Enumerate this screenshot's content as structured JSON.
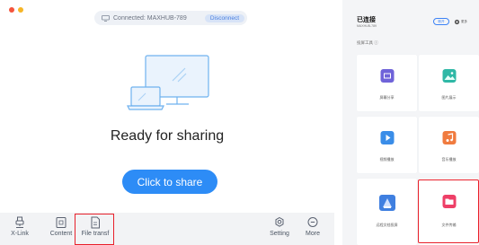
{
  "desktop": {
    "connection_text": "Connected: MAXHUB-789",
    "disconnect_label": "Disconnect",
    "ready_text": "Ready for sharing",
    "share_button": "Click to share",
    "toolbar": [
      {
        "label": "X-Link",
        "icon": "usb-plug-icon"
      },
      {
        "label": "Content",
        "icon": "content-icon"
      },
      {
        "label": "File transf",
        "icon": "file-icon"
      },
      {
        "label": "Setting",
        "icon": "gear-icon"
      },
      {
        "label": "More",
        "icon": "more-icon"
      }
    ],
    "colors": {
      "accent": "#2d8cf6",
      "highlight": "#e8202a"
    }
  },
  "mobile": {
    "title": "已连接",
    "subtitle": "MAXHUB-789",
    "disconnect_label": "断开",
    "more_label": "更多",
    "section_title": "投屏工具 ⓘ",
    "tiles": [
      {
        "label": "屏幕分享",
        "icon": "screen-share-icon",
        "color": "#6f63d9"
      },
      {
        "label": "图片展示",
        "icon": "image-icon",
        "color": "#2fb8a6"
      },
      {
        "label": "视频播放",
        "icon": "video-play-icon",
        "color": "#3a8de8"
      },
      {
        "label": "音乐播放",
        "icon": "music-icon",
        "color": "#f07b3f"
      },
      {
        "label": "远程文档投屏",
        "icon": "document-icon",
        "color": "#3f7fe0"
      },
      {
        "label": "文件传输",
        "icon": "folder-icon",
        "color": "#ee3f67"
      }
    ]
  }
}
